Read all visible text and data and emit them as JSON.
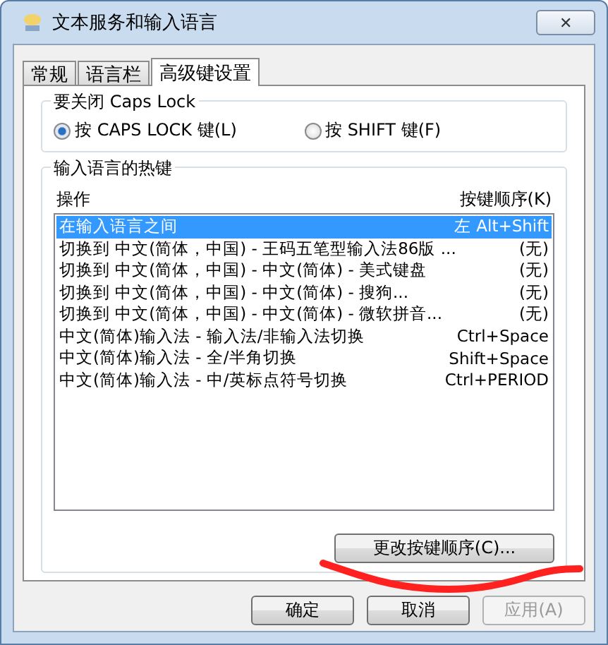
{
  "window": {
    "title": "文本服务和输入语言",
    "close": "✕"
  },
  "tabs": [
    {
      "label": "常规",
      "selected": false
    },
    {
      "label": "语言栏",
      "selected": false
    },
    {
      "label": "高级键设置",
      "selected": true
    }
  ],
  "caps_lock": {
    "title": "要关闭 Caps Lock",
    "options": [
      {
        "label": "按 CAPS LOCK 键(L)",
        "selected": true
      },
      {
        "label": "按 SHIFT 键(F)",
        "selected": false
      }
    ]
  },
  "hotkeys": {
    "title": "输入语言的热键",
    "columns": [
      "操作",
      "按键顺序(K)"
    ],
    "rows": [
      {
        "action": "在输入语言之间",
        "keys": "左 Alt+Shift",
        "selected": true
      },
      {
        "action": "切换到 中文(简体，中国) - 王码五笔型输入法86版 ...",
        "keys": "(无)",
        "selected": false
      },
      {
        "action": "切换到 中文(简体，中国) - 中文(简体) - 美式键盘",
        "keys": "(无)",
        "selected": false
      },
      {
        "action": "切换到 中文(简体，中国) - 中文(简体) - 搜狗...",
        "keys": "(无)",
        "selected": false
      },
      {
        "action": "切换到 中文(简体，中国) - 中文(简体) - 微软拼音...",
        "keys": "(无)",
        "selected": false
      },
      {
        "action": "中文(简体)输入法 - 输入法/非输入法切换",
        "keys": "Ctrl+Space",
        "selected": false
      },
      {
        "action": "中文(简体)输入法 - 全/半角切换",
        "keys": "Shift+Space",
        "selected": false
      },
      {
        "action": "中文(简体)输入法 - 中/英标点符号切换",
        "keys": "Ctrl+PERIOD",
        "selected": false
      }
    ],
    "change_button": "更改按键顺序(C)..."
  },
  "buttons": [
    {
      "label": "确定",
      "disabled": false
    },
    {
      "label": "取消",
      "disabled": false
    },
    {
      "label": "应用(A)",
      "disabled": true
    }
  ]
}
